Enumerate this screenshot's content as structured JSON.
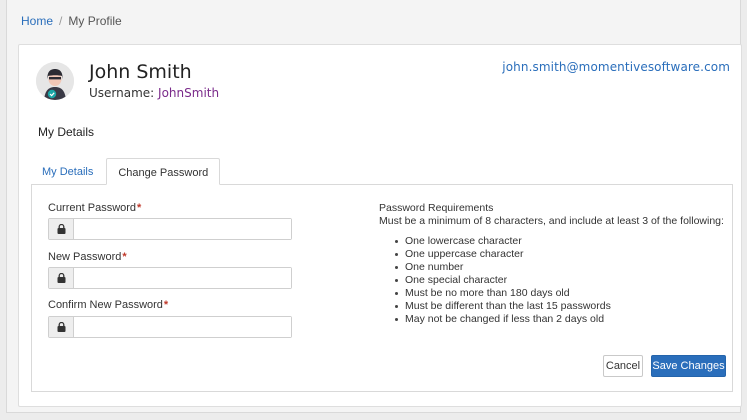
{
  "breadcrumb": {
    "home": "Home",
    "separator": "/",
    "current": "My Profile"
  },
  "profile": {
    "name": "John Smith",
    "username_label": "Username:",
    "username_value": "JohnSmith",
    "email": "john.smith@momentivesoftware.com",
    "avatar_icon": "user-avatar-icon"
  },
  "section": {
    "title": "My Details"
  },
  "tabs": [
    {
      "label": "My Details",
      "active": false
    },
    {
      "label": "Change Password",
      "active": true
    }
  ],
  "form": {
    "current_password": {
      "label": "Current Password",
      "value": "",
      "placeholder": ""
    },
    "new_password": {
      "label": "New Password",
      "value": "",
      "placeholder": ""
    },
    "confirm_password": {
      "label": "Confirm New Password",
      "value": "",
      "placeholder": ""
    },
    "required_marker": "*",
    "lock_icon": "lock-icon"
  },
  "requirements": {
    "title": "Password Requirements",
    "description": "Must be a minimum of 8 characters, and include at least 3 of the following:",
    "items": [
      "One lowercase character",
      "One uppercase character",
      "One number",
      "One special character",
      "Must be no more than 180 days old",
      "Must be different than the last 15 passwords",
      "May not be changed if less than 2 days old"
    ]
  },
  "buttons": {
    "cancel": "Cancel",
    "save": "Save Changes"
  },
  "colors": {
    "link": "#2a6ebb",
    "primary": "#2a6ebb",
    "username": "#7a2a8a",
    "required": "#c0392b",
    "badge": "#1aa6a6"
  }
}
